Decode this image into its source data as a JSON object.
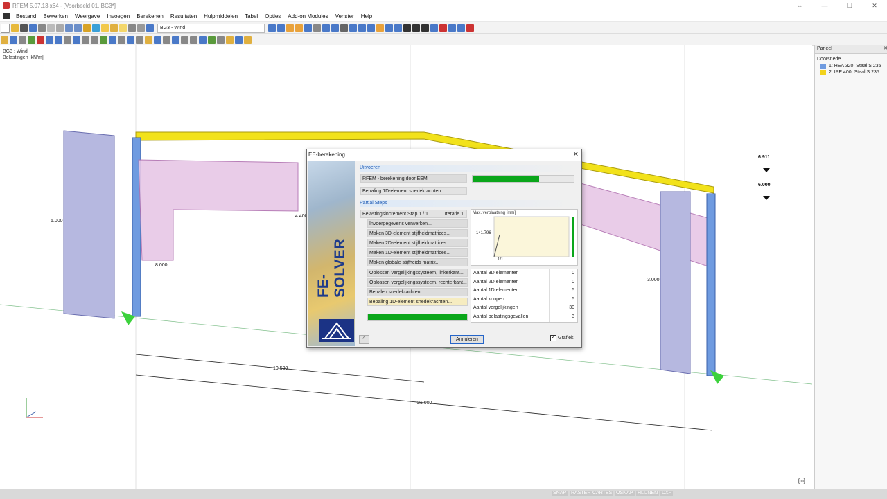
{
  "window": {
    "title": "RFEM 5.07.13 x64 - [Voorbeeld 01, BG3*]"
  },
  "menu": [
    "Bestand",
    "Bewerken",
    "Weergave",
    "Invoegen",
    "Berekenen",
    "Resultaten",
    "Hulpmiddelen",
    "Tabel",
    "Opties",
    "Add-on Modules",
    "Venster",
    "Help"
  ],
  "toolbar": {
    "loadcase": "BG3 - Wind"
  },
  "view": {
    "loadcase_label": "BG3 : Wind",
    "unit_label": "Belastingen [kN/m]",
    "unit_corner": "[m]"
  },
  "model_labels": {
    "left_load": "5.000",
    "left_load_bottom": "8.000",
    "mid_load": "4.400",
    "right_load": "3.000",
    "dim_1": "10.500",
    "dim_2": "21.000",
    "disp_1": "6.911",
    "disp_2": "6.000"
  },
  "panel": {
    "title": "Paneel",
    "section": "Doorsnede",
    "items": [
      {
        "label": "1: HEA 320; Staal S 235",
        "color": "#6f9be0"
      },
      {
        "label": "2: IPE 400; Staal S 235",
        "color": "#f2d21b"
      }
    ]
  },
  "dialog": {
    "title": "EE-berekening...",
    "logo_text": "FE-SOLVER",
    "sec_run": "Uitvoeren",
    "run_tasks": [
      "RFEM - berekening door EEM",
      "Bepaling 1D-element snedekrachten..."
    ],
    "run_progress": 0.66,
    "sec_partial": "Partial Steps",
    "increment_label": "Belastingsincrement Stap 1 / 1",
    "iteration_label": "Iteratie 1",
    "steps": [
      "Invoergegevens verwerken...",
      "Maken 3D-element stijfheidmatrices...",
      "Maken 2D-element stijfheidmatrices...",
      "Maken 1D-element stijfheidmatrices...",
      "Maken globale stijfheids matrix...",
      "Oplossen vergelijkingssysteem, linkerkant...",
      "Oplossen vergelijkingssysteem, rechterkant...",
      "Bepalen snedekrachten...",
      "Bepaling 1D-element snedekrachten..."
    ],
    "step_progress": 1.0,
    "graph_title": "Max. verplaatsing [mm]",
    "graph_value": "141.796",
    "graph_x": "1/1",
    "stats": [
      {
        "label": "Aantal 3D elementen",
        "value": "0"
      },
      {
        "label": "Aantal 2D elementen",
        "value": "0"
      },
      {
        "label": "Aantal 1D elementen",
        "value": "5"
      },
      {
        "label": "Aantal knopen",
        "value": "5"
      },
      {
        "label": "Aantal vergelijkingen",
        "value": "30"
      },
      {
        "label": "Aantal belastingsgevallen",
        "value": "3"
      }
    ],
    "cancel_label": "Annuleren",
    "graph_check_label": "Grafiek"
  },
  "statusbar": [
    "SNAP",
    "RASTER",
    "CARTES",
    "OSNAP",
    "HLIJNEN",
    "DXF"
  ]
}
